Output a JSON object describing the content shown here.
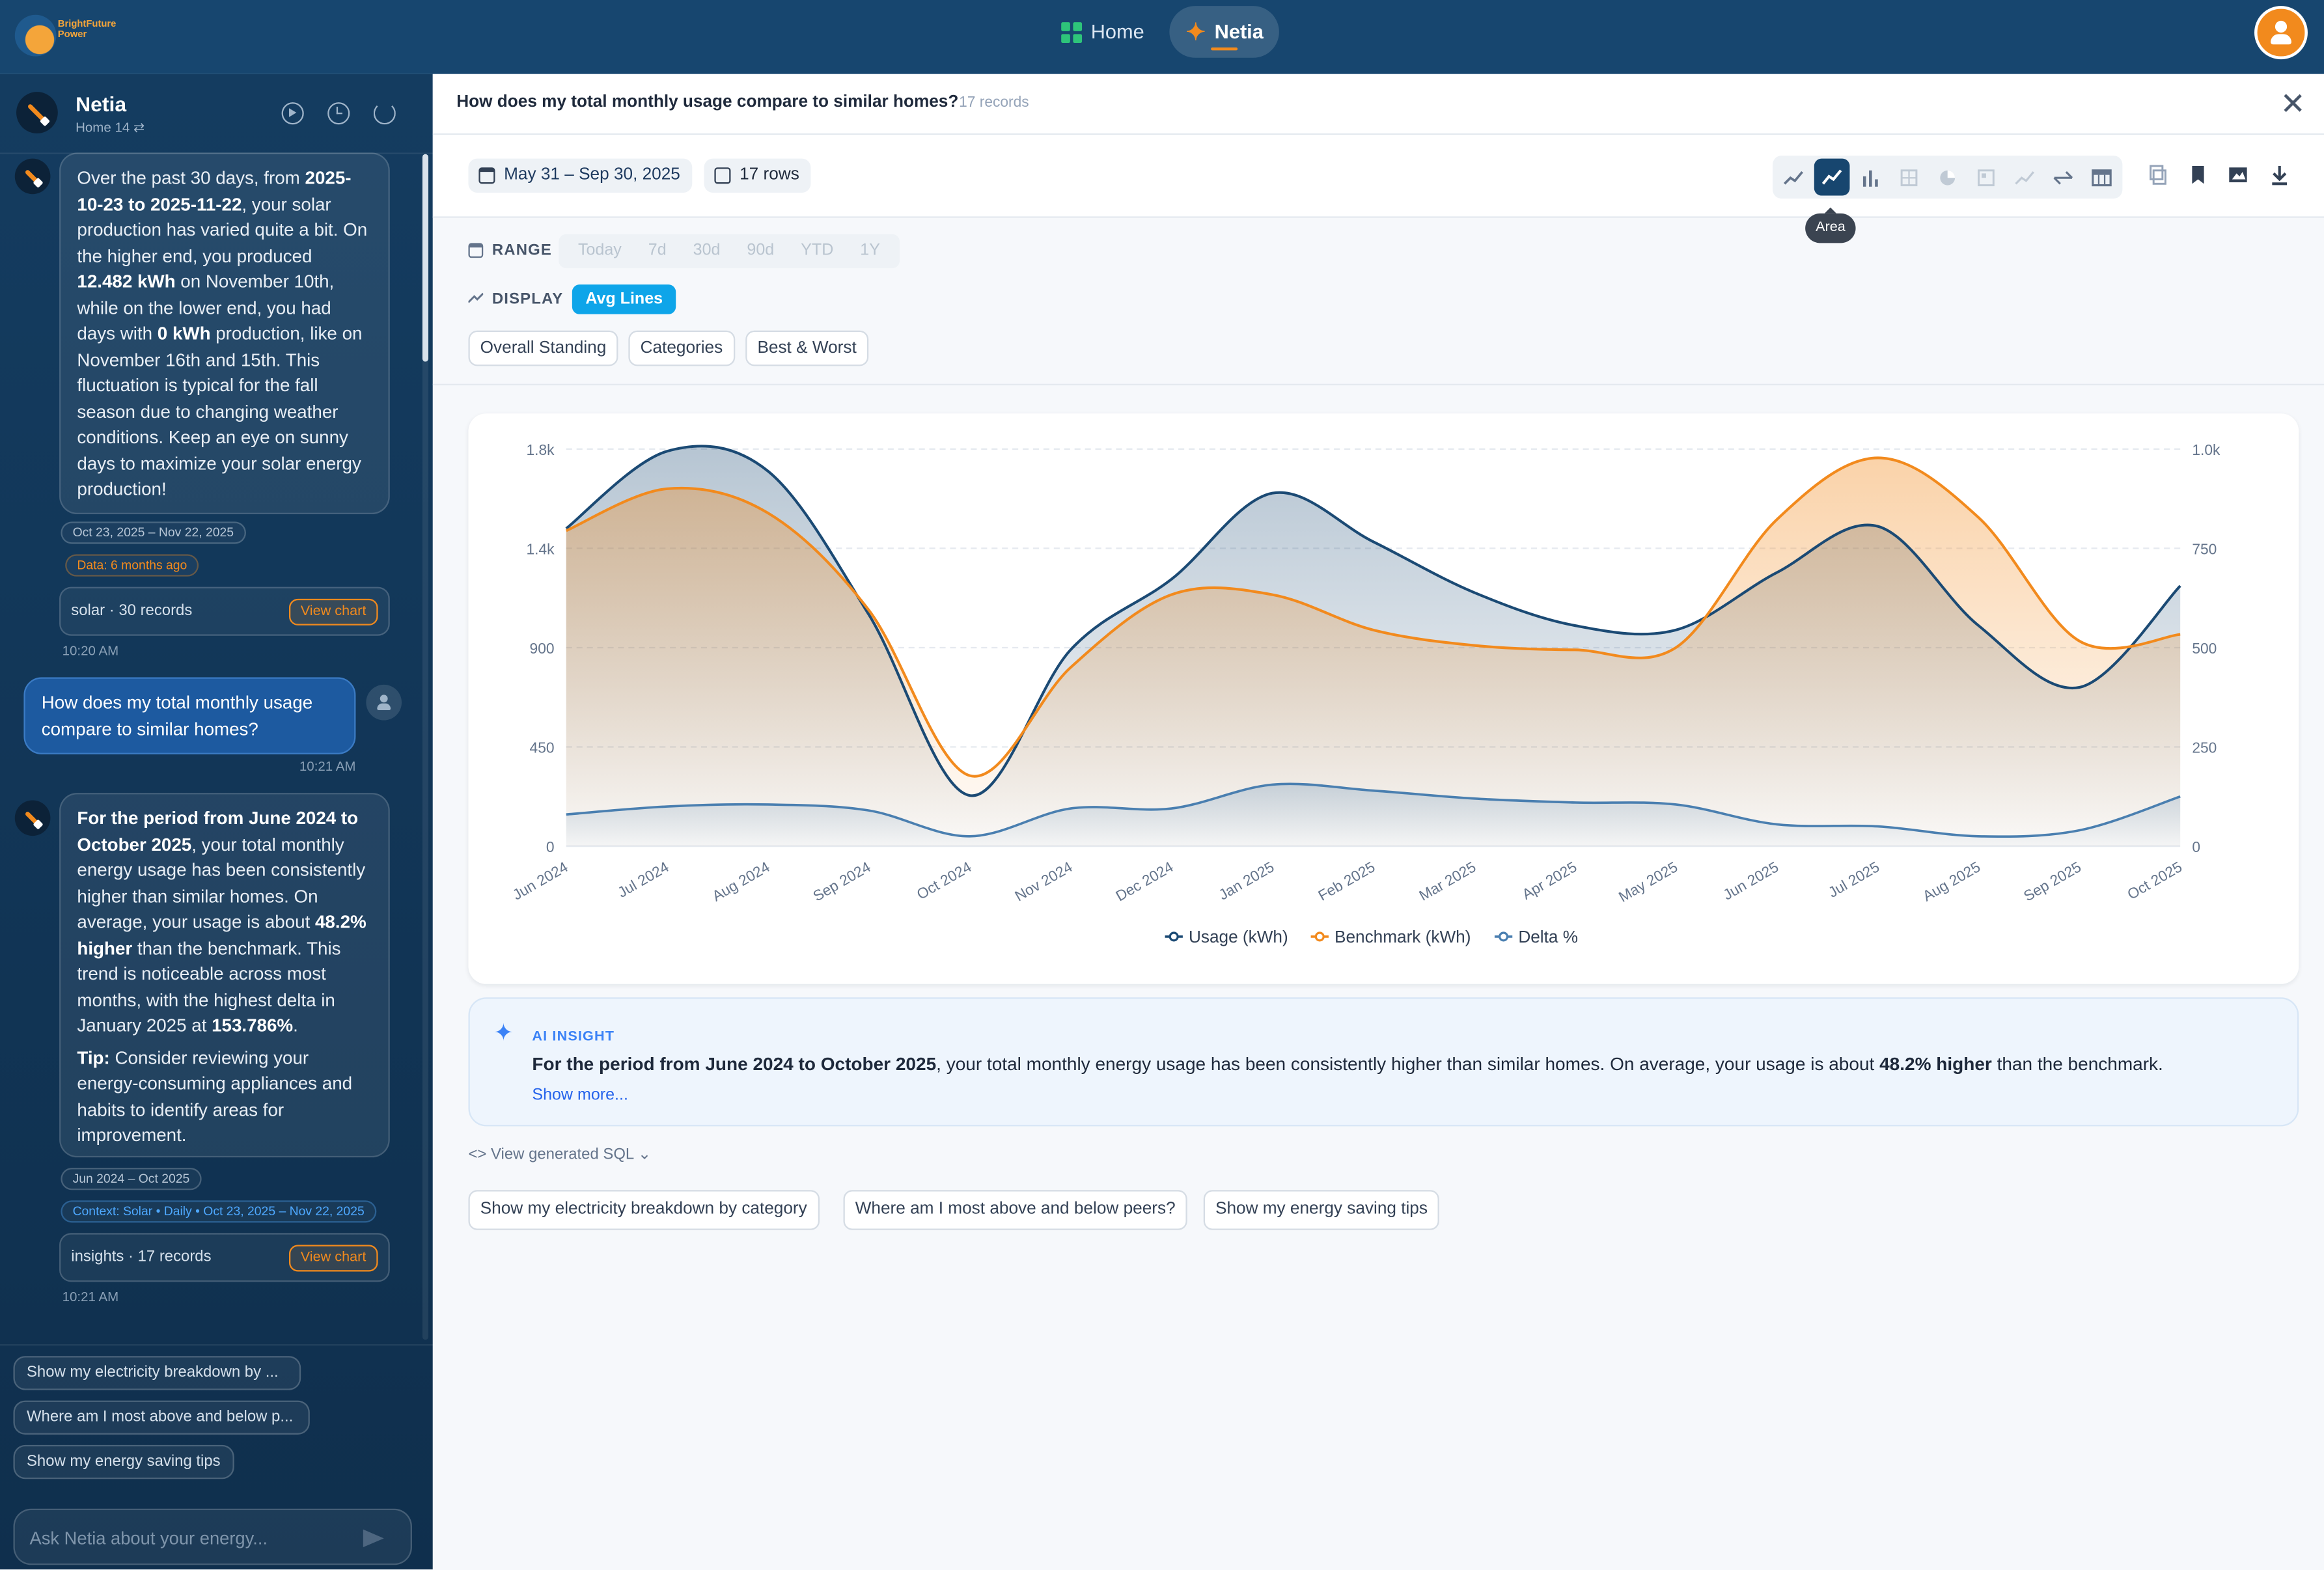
{
  "topbar": {
    "logo_line1": "BrightFuture",
    "logo_line2": "Power",
    "nav": [
      {
        "label": "Home",
        "active": false
      },
      {
        "label": "Netia",
        "active": true
      }
    ]
  },
  "sidebar": {
    "title": "Netia",
    "subtitle": "Home 14 ⇄",
    "messages": {
      "solar_bubble_html": "Over the past 30 days, from <b>2025-10-23 to 2025-11-22</b>, your solar production has varied quite a bit. On the higher end, you produced <b>12.482 kWh</b> on November 10th, while on the lower end, you had days with <b>0 kWh</b> production, like on November 16th and 15th. This fluctuation is typical for the fall season due to changing weather conditions. Keep an eye on sunny days to maximize your solar energy production!",
      "solar_chip_range": "Oct 23, 2025 – Nov 22, 2025",
      "solar_chip_age": "Data: 6 months ago",
      "solar_records": "solar · 30 records",
      "view_chart": "View chart",
      "solar_time": "10:20 AM",
      "user_question": "How does my total monthly usage compare to similar homes?",
      "user_time": "10:21 AM",
      "insight_bubble_p1_html": "<b>For the period from June 2024 to October 2025</b>, your total monthly energy usage has been consistently higher than similar homes. On average, your usage is about <b>48.2% higher</b> than the benchmark. This trend is noticeable across most months, with the highest delta in January 2025 at <b>153.786%</b>.",
      "insight_bubble_p2_html": "<b>Tip:</b> Consider reviewing your energy-consuming appliances and habits to identify areas for improvement.",
      "insight_chip_range": "Jun 2024 – Oct 2025",
      "insight_chip_context": "Context: Solar • Daily • Oct 23, 2025 – Nov 22, 2025",
      "insight_records": "insights · 17 records",
      "insight_time": "10:21 AM"
    },
    "suggestions": [
      "Show my electricity breakdown by ...",
      "Where am I most above and below p...",
      "Show my energy saving tips"
    ],
    "input_placeholder": "Ask Netia about your energy..."
  },
  "main": {
    "question": "How does my total monthly usage compare to similar homes?",
    "records": "17 records",
    "date_range": "May 31 – Sep 30, 2025",
    "rows": "17 rows",
    "tooltip": "Area",
    "chart_types": [
      "line-icon",
      "area-icon",
      "bar-icon",
      "grid-icon",
      "pie-icon",
      "heatmap-icon",
      "trend-icon",
      "compare-icon",
      "table-icon"
    ],
    "range_label": "RANGE",
    "range_options": [
      "Today",
      "7d",
      "30d",
      "90d",
      "YTD",
      "1Y"
    ],
    "display_label": "DISPLAY",
    "display_value": "Avg Lines",
    "segments": [
      "Overall Standing",
      "Categories",
      "Best & Worst"
    ],
    "insight": {
      "label": "AI INSIGHT",
      "bold_lead": "For the period from June 2024 to October 2025",
      "text_mid": ", your total monthly energy usage has been consistently higher than similar homes. On average, your usage is about ",
      "bold_pct": "48.2% higher",
      "text_end": " than the benchmark.",
      "show_more": "Show more..."
    },
    "sql_link": "View generated SQL",
    "followups": [
      "Show my electricity breakdown by category",
      "Where am I most above and below peers?",
      "Show my energy saving tips"
    ]
  },
  "colors": {
    "usage": "#1b4a74",
    "benchmark": "#f28a1d",
    "delta": "#4a7fb0",
    "topbar": "#17466f",
    "accent": "#f28a1d"
  },
  "chart_data": {
    "type": "area",
    "categories": [
      "Jun 2024",
      "Jul 2024",
      "Aug 2024",
      "Sep 2024",
      "Oct 2024",
      "Nov 2024",
      "Dec 2024",
      "Jan 2025",
      "Feb 2025",
      "Mar 2025",
      "Apr 2025",
      "May 2025",
      "Jun 2025",
      "Jul 2025",
      "Aug 2025",
      "Sep 2025",
      "Oct 2025"
    ],
    "series": [
      {
        "name": "Usage (kWh)",
        "axis": "left",
        "values": [
          1440,
          1790,
          1700,
          1050,
          230,
          890,
          1210,
          1600,
          1380,
          1150,
          1000,
          980,
          1240,
          1450,
          1000,
          720,
          1180
        ]
      },
      {
        "name": "Benchmark (kWh)",
        "axis": "left",
        "values": [
          1430,
          1620,
          1510,
          1070,
          320,
          810,
          1140,
          1140,
          980,
          910,
          890,
          900,
          1480,
          1760,
          1490,
          930,
          960
        ]
      },
      {
        "name": "Delta %",
        "axis": "right",
        "values": [
          80,
          100,
          105,
          90,
          25,
          95,
          95,
          155,
          140,
          120,
          110,
          105,
          55,
          50,
          25,
          40,
          125
        ]
      }
    ],
    "ylim_left": [
      0,
      1800
    ],
    "yticks_left": [
      "0",
      "450",
      "900",
      "1.4k",
      "1.8k"
    ],
    "ylim_right": [
      0,
      1000
    ],
    "yticks_right": [
      "0",
      "250",
      "500",
      "750",
      "1.0k"
    ],
    "grid": true,
    "legend": "bottom-center"
  }
}
